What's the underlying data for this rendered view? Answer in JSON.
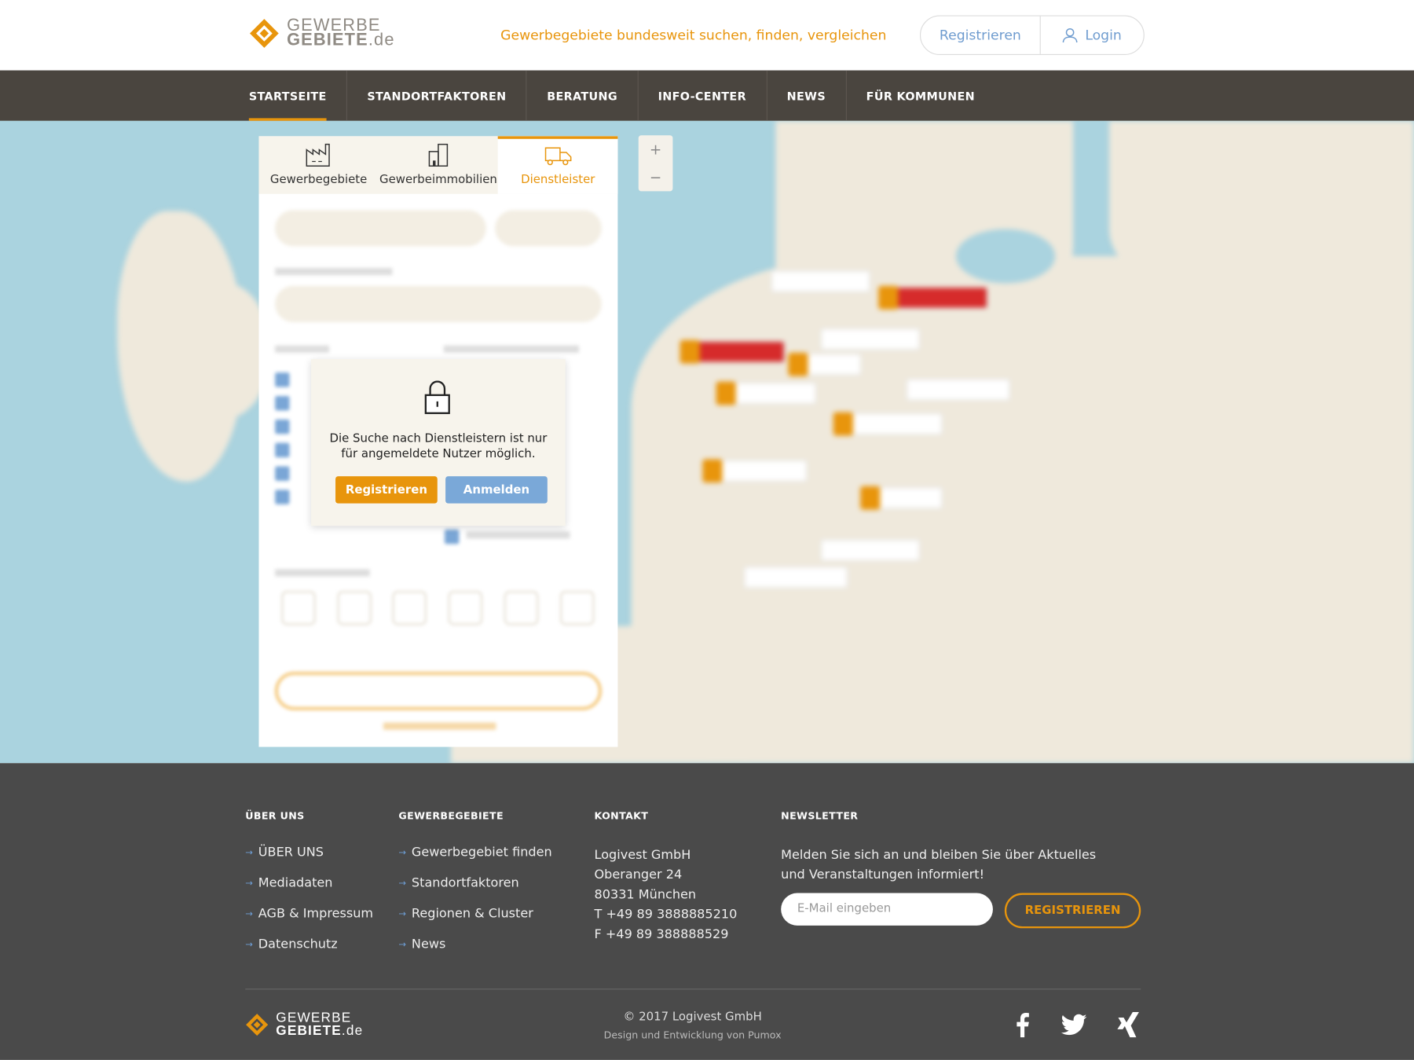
{
  "header": {
    "logo_line1": "GEWERBE",
    "logo_line2": "GEBIETE",
    "logo_suffix": ".de",
    "tagline": "Gewerbegebiete bundesweit suchen, finden, vergleichen",
    "register_label": "Registrieren",
    "login_label": "Login"
  },
  "nav": {
    "items": [
      "STARTSEITE",
      "STANDORTFAKTOREN",
      "BERATUNG",
      "INFO-CENTER",
      "NEWS",
      "FÜR KOMMUNEN"
    ],
    "active": "STARTSEITE"
  },
  "search_panel": {
    "tabs": [
      "Gewerbegebiete",
      "Gewerbeimmobilien",
      "Dienstleister"
    ],
    "active_tab": "Dienstleister"
  },
  "modal": {
    "message": "Die Suche nach Dienstleistern ist nur für angemeldete Nutzer möglich.",
    "register_label": "Registrieren",
    "login_label": "Anmelden"
  },
  "footer": {
    "col1": {
      "heading": "ÜBER UNS",
      "links": [
        "ÜBER UNS",
        "Mediadaten",
        "AGB & Impressum",
        "Datenschutz"
      ]
    },
    "col2": {
      "heading": "GEWERBEGEBIETE",
      "links": [
        "Gewerbegebiet finden",
        "Standortfaktoren",
        "Regionen & Cluster",
        "News"
      ]
    },
    "col3": {
      "heading": "KONTAKT",
      "lines": [
        "Logivest GmbH",
        "Oberanger 24",
        "80331 München",
        "T +49 89 3888885210",
        "F +49 89 388888529"
      ]
    },
    "newsletter": {
      "heading": "NEWSLETTER",
      "text_line1": "Melden Sie sich an und bleiben Sie über Aktuelles",
      "text_line2": "und Veranstaltungen informiert!",
      "input_placeholder": "E-Mail eingeben",
      "button_label": "REGISTRIEREN"
    },
    "copyright": "© 2017 Logivest GmbH",
    "credit": "Design und Entwicklung von Pumox",
    "social_icons": [
      "facebook-icon",
      "twitter-icon",
      "xing-icon"
    ]
  },
  "colors": {
    "accent": "#e8950c",
    "nav_bg": "#4a453f",
    "footer_bg": "#4a4a4a",
    "link_blue": "#6f9ccf"
  }
}
